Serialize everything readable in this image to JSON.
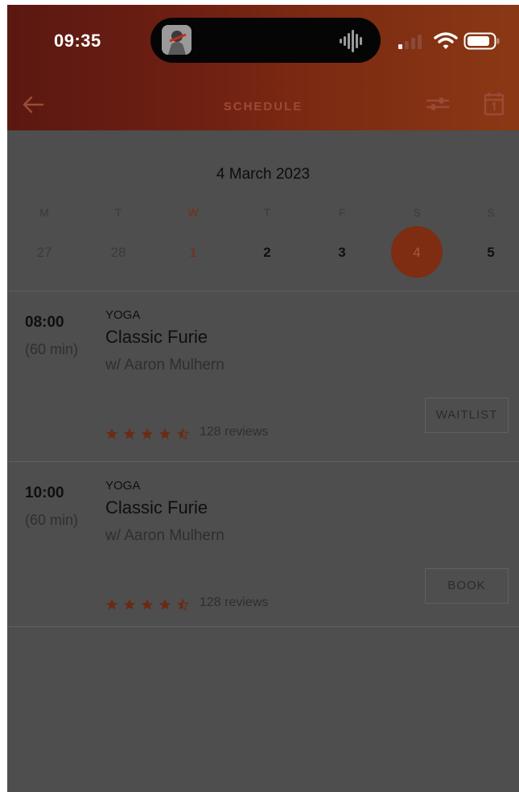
{
  "status_bar": {
    "time": "09:35"
  },
  "header": {
    "title": "SCHEDULE"
  },
  "calendar": {
    "month_label": "4 March 2023",
    "days": [
      {
        "letter": "M",
        "number": "27"
      },
      {
        "letter": "T",
        "number": "28"
      },
      {
        "letter": "W",
        "number": "1"
      },
      {
        "letter": "T",
        "number": "2"
      },
      {
        "letter": "F",
        "number": "3"
      },
      {
        "letter": "S",
        "number": "4"
      },
      {
        "letter": "S",
        "number": "5"
      }
    ],
    "selected_day": "4"
  },
  "classes": [
    {
      "time": "08:00",
      "duration": "(60 min)",
      "category": "YOGA",
      "name": "Classic Furie",
      "instructor": "w/ Aaron Mulhern",
      "rating": 4.5,
      "reviews": "128 reviews",
      "action": "WAITLIST"
    },
    {
      "time": "10:00",
      "duration": "(60 min)",
      "category": "YOGA",
      "name": "Classic Furie",
      "instructor": "w/ Aaron Mulhern",
      "rating": 4.5,
      "reviews": "128 reviews",
      "action": "BOOK"
    }
  ],
  "colors": {
    "accent": "#7e2c12",
    "overlay": "#4d4e4d"
  },
  "icons": [
    "back-arrow-icon",
    "filter-icon",
    "calendar-icon",
    "signal-icon",
    "wifi-icon",
    "battery-icon",
    "star-icon",
    "half-star-icon"
  ]
}
